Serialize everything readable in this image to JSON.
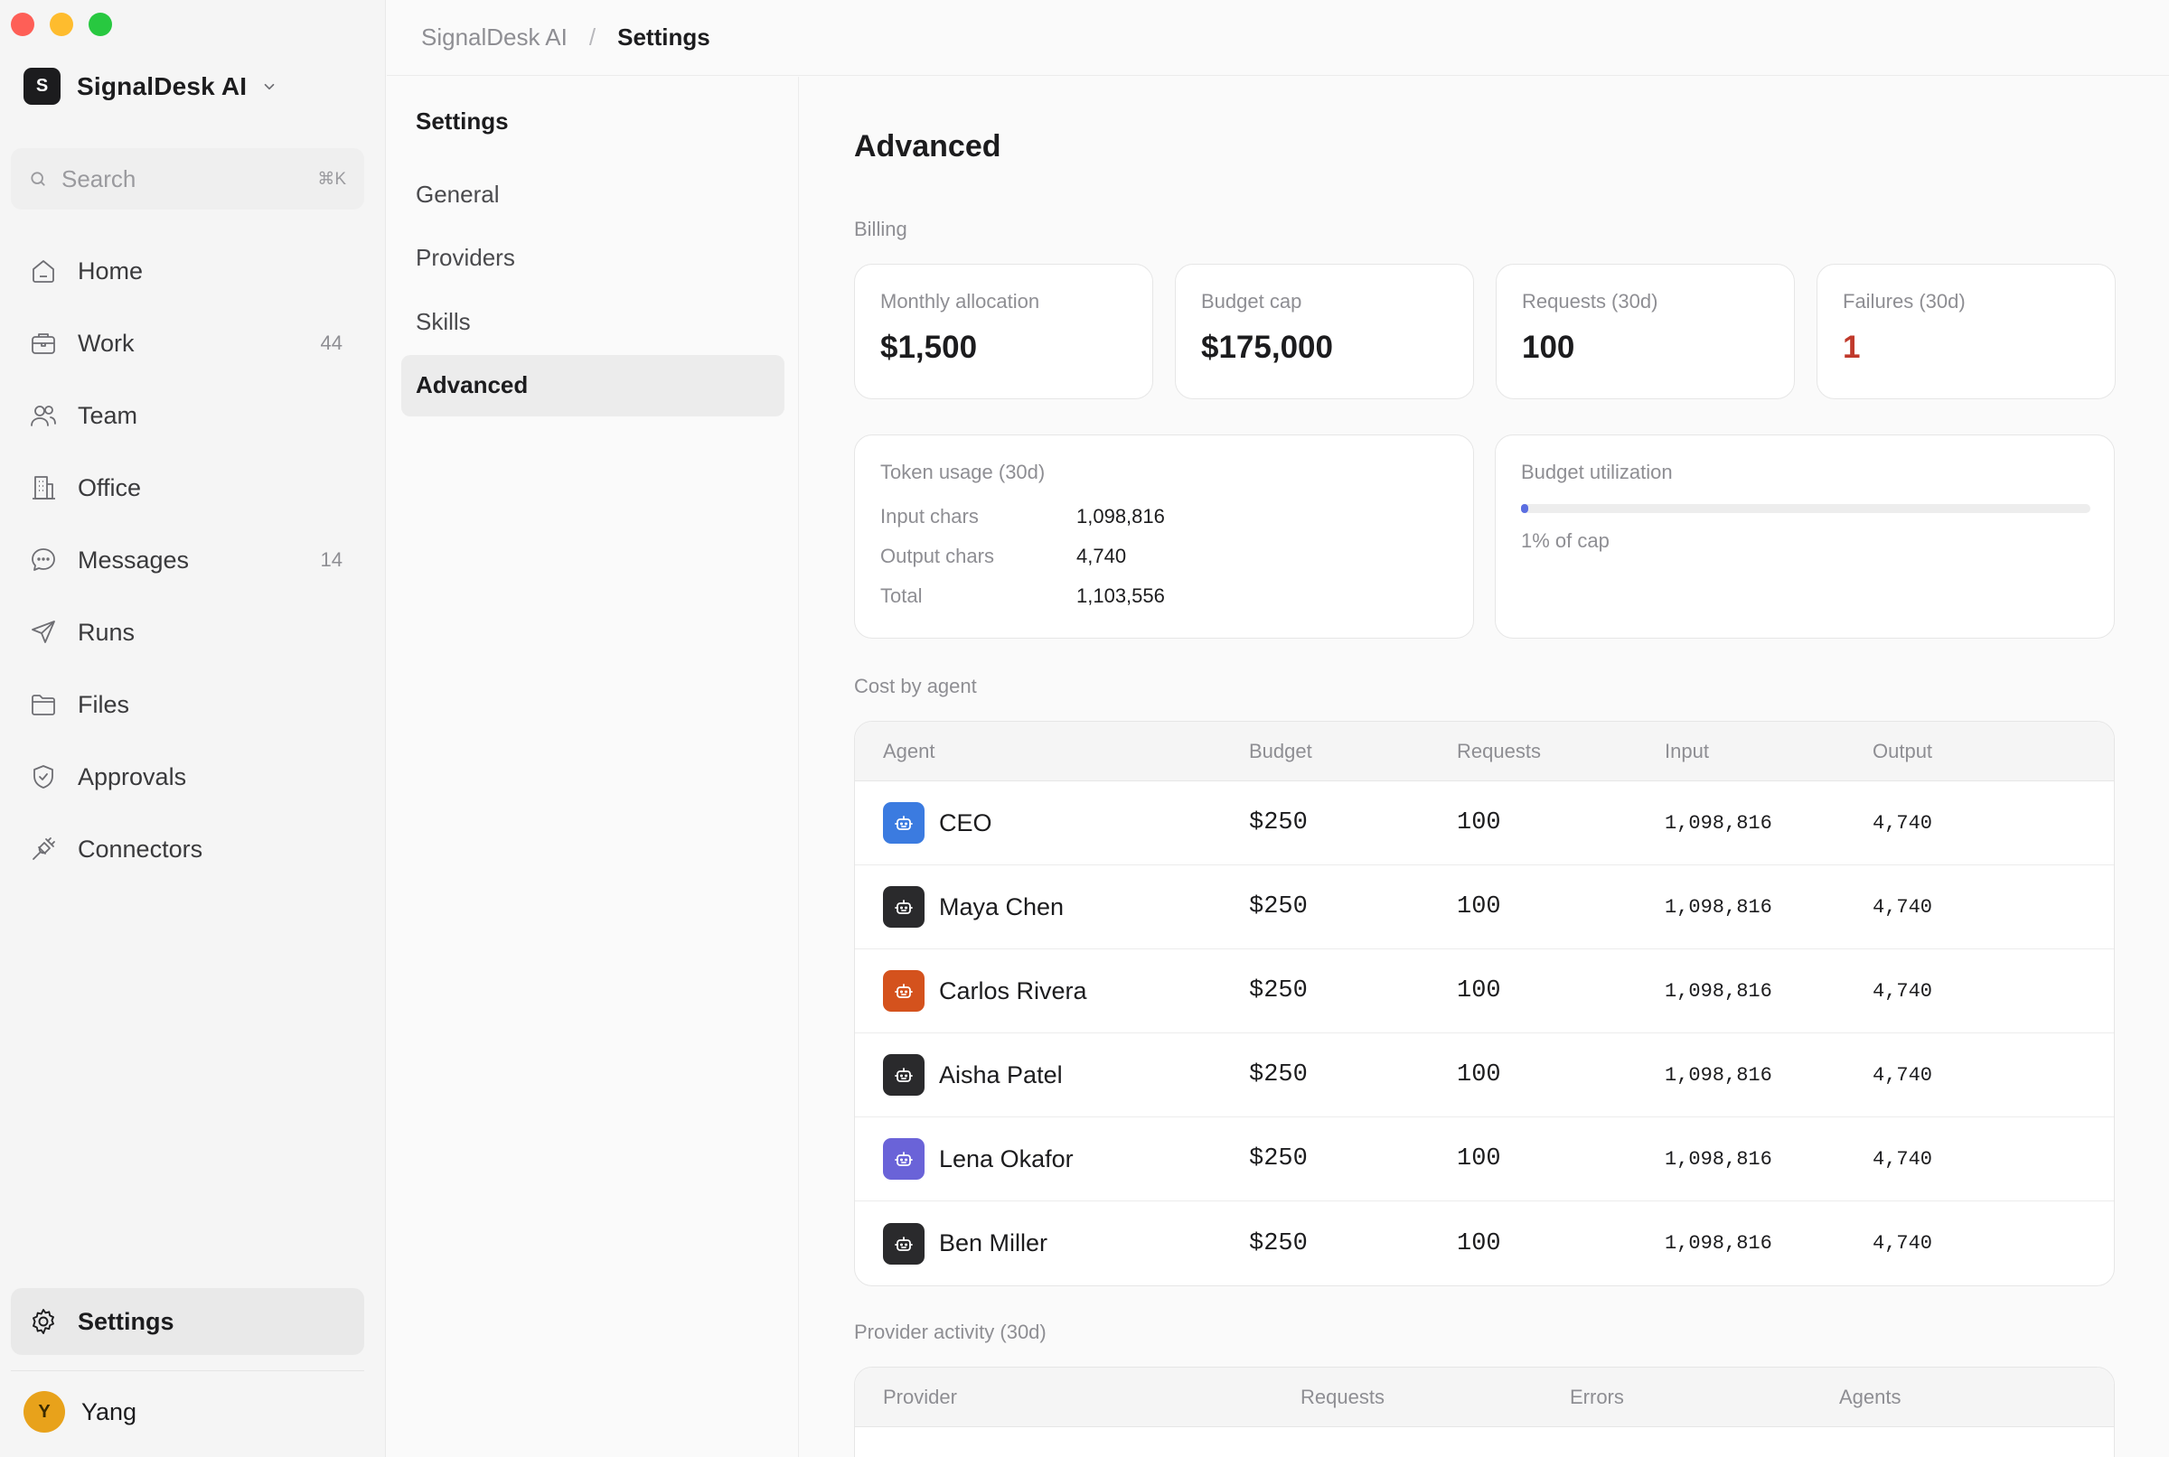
{
  "window": {
    "controls": [
      "close",
      "minimize",
      "zoom"
    ]
  },
  "workspace": {
    "initial": "S",
    "name": "SignalDesk AI"
  },
  "search": {
    "placeholder": "Search",
    "shortcut": "⌘K"
  },
  "nav": {
    "items": [
      {
        "label": "Home",
        "icon": "home-icon",
        "count": ""
      },
      {
        "label": "Work",
        "icon": "briefcase-icon",
        "count": "44"
      },
      {
        "label": "Team",
        "icon": "users-icon",
        "count": ""
      },
      {
        "label": "Office",
        "icon": "building-icon",
        "count": ""
      },
      {
        "label": "Messages",
        "icon": "message-icon",
        "count": "14"
      },
      {
        "label": "Runs",
        "icon": "send-icon",
        "count": ""
      },
      {
        "label": "Files",
        "icon": "folder-icon",
        "count": ""
      },
      {
        "label": "Approvals",
        "icon": "shield-check-icon",
        "count": ""
      },
      {
        "label": "Connectors",
        "icon": "plug-icon",
        "count": ""
      }
    ],
    "settings_label": "Settings"
  },
  "user": {
    "initial": "Y",
    "name": "Yang"
  },
  "breadcrumb": {
    "parent": "SignalDesk AI",
    "separator": "/",
    "current": "Settings"
  },
  "subnav": {
    "title": "Settings",
    "items": [
      "General",
      "Providers",
      "Skills",
      "Advanced"
    ],
    "active": "Advanced"
  },
  "page": {
    "title": "Advanced",
    "billing_label": "Billing",
    "stats": [
      {
        "label": "Monthly allocation",
        "value": "$1,500",
        "status": "normal"
      },
      {
        "label": "Budget cap",
        "value": "$175,000",
        "status": "normal"
      },
      {
        "label": "Requests (30d)",
        "value": "100",
        "status": "normal"
      },
      {
        "label": "Failures (30d)",
        "value": "1",
        "status": "danger"
      }
    ],
    "token_usage": {
      "title": "Token usage (30d)",
      "rows": [
        {
          "label": "Input chars",
          "value": "1,098,816"
        },
        {
          "label": "Output chars",
          "value": "4,740"
        },
        {
          "label": "Total",
          "value": "1,103,556"
        }
      ]
    },
    "budget_utilization": {
      "title": "Budget utilization",
      "fraction": 0.01,
      "note": "1% of cap"
    },
    "cost_by_agent": {
      "label": "Cost by agent",
      "columns": [
        "Agent",
        "Budget",
        "Requests",
        "Input",
        "Output"
      ],
      "rows": [
        {
          "agent": "CEO",
          "icon_color": "#3b7be0",
          "budget": "$250",
          "requests": "100",
          "input": "1,098,816",
          "output": "4,740"
        },
        {
          "agent": "Maya Chen",
          "icon_color": "#2a2a2c",
          "budget": "$250",
          "requests": "100",
          "input": "1,098,816",
          "output": "4,740"
        },
        {
          "agent": "Carlos Rivera",
          "icon_color": "#d4521d",
          "budget": "$250",
          "requests": "100",
          "input": "1,098,816",
          "output": "4,740"
        },
        {
          "agent": "Aisha Patel",
          "icon_color": "#2a2a2c",
          "budget": "$250",
          "requests": "100",
          "input": "1,098,816",
          "output": "4,740"
        },
        {
          "agent": "Lena Okafor",
          "icon_color": "#6a63d8",
          "budget": "$250",
          "requests": "100",
          "input": "1,098,816",
          "output": "4,740"
        },
        {
          "agent": "Ben Miller",
          "icon_color": "#2a2a2c",
          "budget": "$250",
          "requests": "100",
          "input": "1,098,816",
          "output": "4,740"
        }
      ]
    },
    "provider_activity": {
      "label": "Provider activity (30d)",
      "columns": [
        "Provider",
        "Requests",
        "Errors",
        "Agents"
      ]
    }
  },
  "colors": {
    "accent": "#5b6ee1",
    "danger": "#c0392b",
    "muted": "#8e8e93"
  }
}
